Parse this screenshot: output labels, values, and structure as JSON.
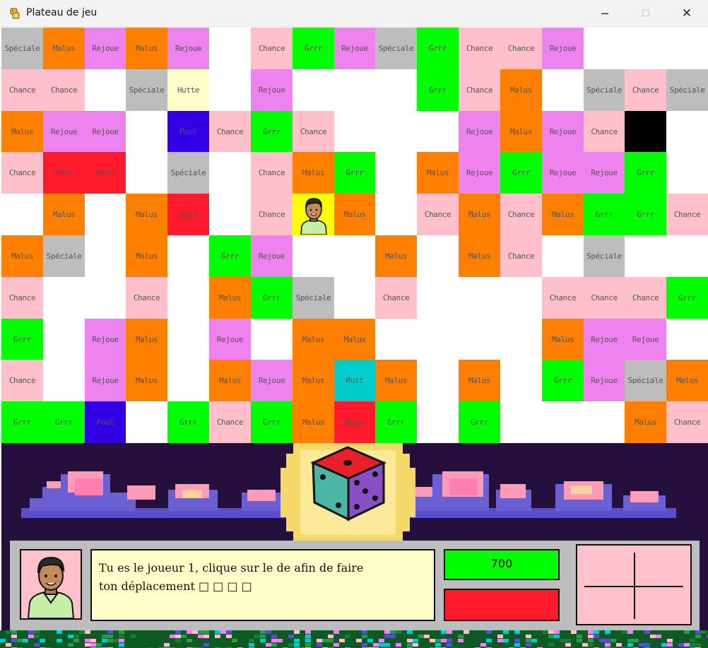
{
  "window": {
    "title": "Plateau de jeu",
    "controls": {
      "minimize": "─",
      "maximize": "☐",
      "close": "✕"
    }
  },
  "colors": {
    "Spéciale": "#bdbdbd",
    "Malus": "#ff7f00",
    "Rejoue": "#ee82ee",
    "Chance": "#ffc0cb",
    "Grrr": "#00ff00",
    "Hutte": "#ffffcc",
    "Poul": "#3300e6",
    "Boss": "#ff1a2c",
    "Puit": "#00cccc",
    "black": "#000000",
    "empty": "#ffffff"
  },
  "board": {
    "rows": [
      [
        "Spéciale",
        "Malus",
        "Rejoue",
        "Malus",
        "Rejoue",
        "",
        "Chance",
        "Grrr",
        "Rejoue",
        "Spéciale",
        "Grrr",
        "Chance",
        "Chance",
        "Rejoue",
        "",
        "",
        ""
      ],
      [
        "Chance",
        "Chance",
        "",
        "Spéciale",
        "Hutte",
        "",
        "Rejoue",
        "",
        "",
        "",
        "Grrr",
        "Chance",
        "Malus",
        "",
        "Spéciale",
        "Chance",
        "Spéciale"
      ],
      [
        "Malus",
        "Rejoue",
        "Rejoue",
        "",
        "Poul",
        "Chance",
        "Grrr",
        "Chance",
        "",
        "",
        "",
        "Rejoue",
        "Malus",
        "Rejoue",
        "Chance",
        "#",
        ""
      ],
      [
        "Chance",
        "Boss",
        "Boss",
        "",
        "Spéciale",
        "",
        "Chance",
        "Malus",
        "Grrr",
        "",
        "Malus",
        "Rejoue",
        "Grrr",
        "Rejoue",
        "Rejoue",
        "Grrr",
        ""
      ],
      [
        "",
        "Malus",
        "",
        "Malus",
        "Boss",
        "",
        "Chance",
        "@",
        "Malus",
        "",
        "Chance",
        "Malus",
        "Chance",
        "Malus",
        "Grrr",
        "Grrr",
        "Chance"
      ],
      [
        "Malus",
        "Spéciale",
        "",
        "Malus",
        "",
        "Grrr",
        "Rejoue",
        "",
        "",
        "Malus",
        "",
        "Malus",
        "Chance",
        "",
        "Spéciale",
        "",
        ""
      ],
      [
        "Chance",
        "",
        "",
        "Chance",
        "",
        "Malus",
        "Grrr",
        "Spéciale",
        "",
        "Chance",
        "",
        "",
        "",
        "Chance",
        "Chance",
        "Chance",
        "Grrr"
      ],
      [
        "Grrr",
        "",
        "Rejoue",
        "Malus",
        "",
        "Rejoue",
        "",
        "Malus",
        "Malus",
        "",
        "",
        "",
        "",
        "Malus",
        "Rejoue",
        "Rejoue",
        ""
      ],
      [
        "Chance",
        "",
        "Rejoue",
        "Malus",
        "",
        "Malus",
        "Rejoue",
        "Malus",
        "Puit",
        "Malus",
        "",
        "Malus",
        "",
        "Grrr",
        "Rejoue",
        "Spéciale",
        "Malus"
      ],
      [
        "Grrr",
        "Grrr",
        "Poul",
        "",
        "Grrr",
        "Chance",
        "Grrr",
        "Malus",
        "Boss",
        "Grrr",
        "",
        "Grrr",
        "",
        "",
        "",
        "Malus",
        "Chance"
      ]
    ]
  },
  "hud": {
    "message_line1": "Tu es le joueur 1, clique sur le de afin de faire",
    "message_line2": "ton déplacement □ □ □ □",
    "score": "700"
  },
  "icons": {
    "app": "python-snake-icon",
    "dice": "dice-icon",
    "player": "player-avatar-icon",
    "dpad": "crosshair-icon"
  }
}
